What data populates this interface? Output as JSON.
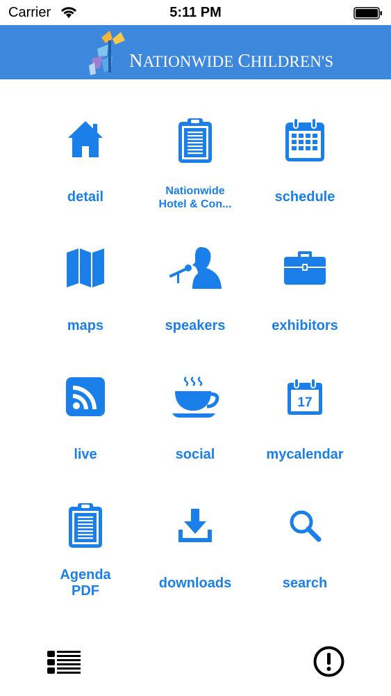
{
  "status_bar": {
    "carrier": "Carrier",
    "time": "5:11 PM"
  },
  "header": {
    "logo_first": "N",
    "logo_rest1": "ATIONWIDE",
    "logo_cap2": "C",
    "logo_rest2": "HILDREN'S"
  },
  "colors": {
    "accent": "#1a7fe8",
    "header_bg": "#3d87dc"
  },
  "tiles": [
    {
      "label": "detail",
      "icon": "home-icon"
    },
    {
      "label1": "Nationwide",
      "label2": "Hotel & Con...",
      "icon": "clipboard-icon"
    },
    {
      "label": "schedule",
      "icon": "calendar-grid-icon"
    },
    {
      "label": "maps",
      "icon": "map-icon"
    },
    {
      "label": "speakers",
      "icon": "speaker-microphone-icon"
    },
    {
      "label": "exhibitors",
      "icon": "briefcase-icon"
    },
    {
      "label": "live",
      "icon": "rss-icon"
    },
    {
      "label": "social",
      "icon": "coffee-cup-icon"
    },
    {
      "label": "mycalendar",
      "icon": "calendar-day-icon",
      "day": "17"
    },
    {
      "label1": "Agenda",
      "label2": "PDF",
      "icon": "clipboard-icon"
    },
    {
      "label": "downloads",
      "icon": "download-icon"
    },
    {
      "label": "search",
      "icon": "search-icon"
    }
  ],
  "bottom": {
    "left_icon": "list-menu-icon",
    "right_icon": "info-alert-icon"
  }
}
